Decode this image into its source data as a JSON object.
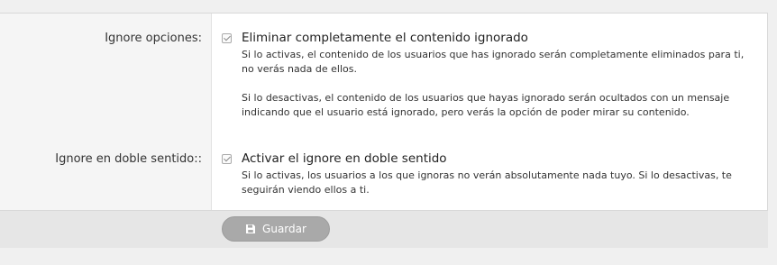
{
  "settings": {
    "rows": [
      {
        "label": "Ignore opciones:",
        "option_title": "Eliminar completamente el contenido ignorado",
        "checked": true,
        "description": [
          "Si lo activas, el contenido de los usuarios que has ignorado serán completamente eliminados para ti, no verás nada de ellos.",
          "Si lo desactivas, el contenido de los usuarios que hayas ignorado serán ocultados con un mensaje indicando que el usuario está ignorado, pero verás la opción de poder mirar su contenido."
        ]
      },
      {
        "label": "Ignore en doble sentido::",
        "option_title": "Activar el ignore en doble sentido",
        "checked": true,
        "description": [
          "Si lo activas, los usuarios a los que ignoras no verán absolutamente nada tuyo. Si lo desactivas, te seguirán viendo ellos a ti."
        ]
      }
    ]
  },
  "footer": {
    "save_label": "Guardar",
    "save_icon": "floppy-disk-icon"
  },
  "colors": {
    "page_bg": "#f0f0f0",
    "label_column_bg": "#f5f5f5",
    "footer_bg": "#e6e6e6",
    "button_bg": "#a9a9a9"
  }
}
